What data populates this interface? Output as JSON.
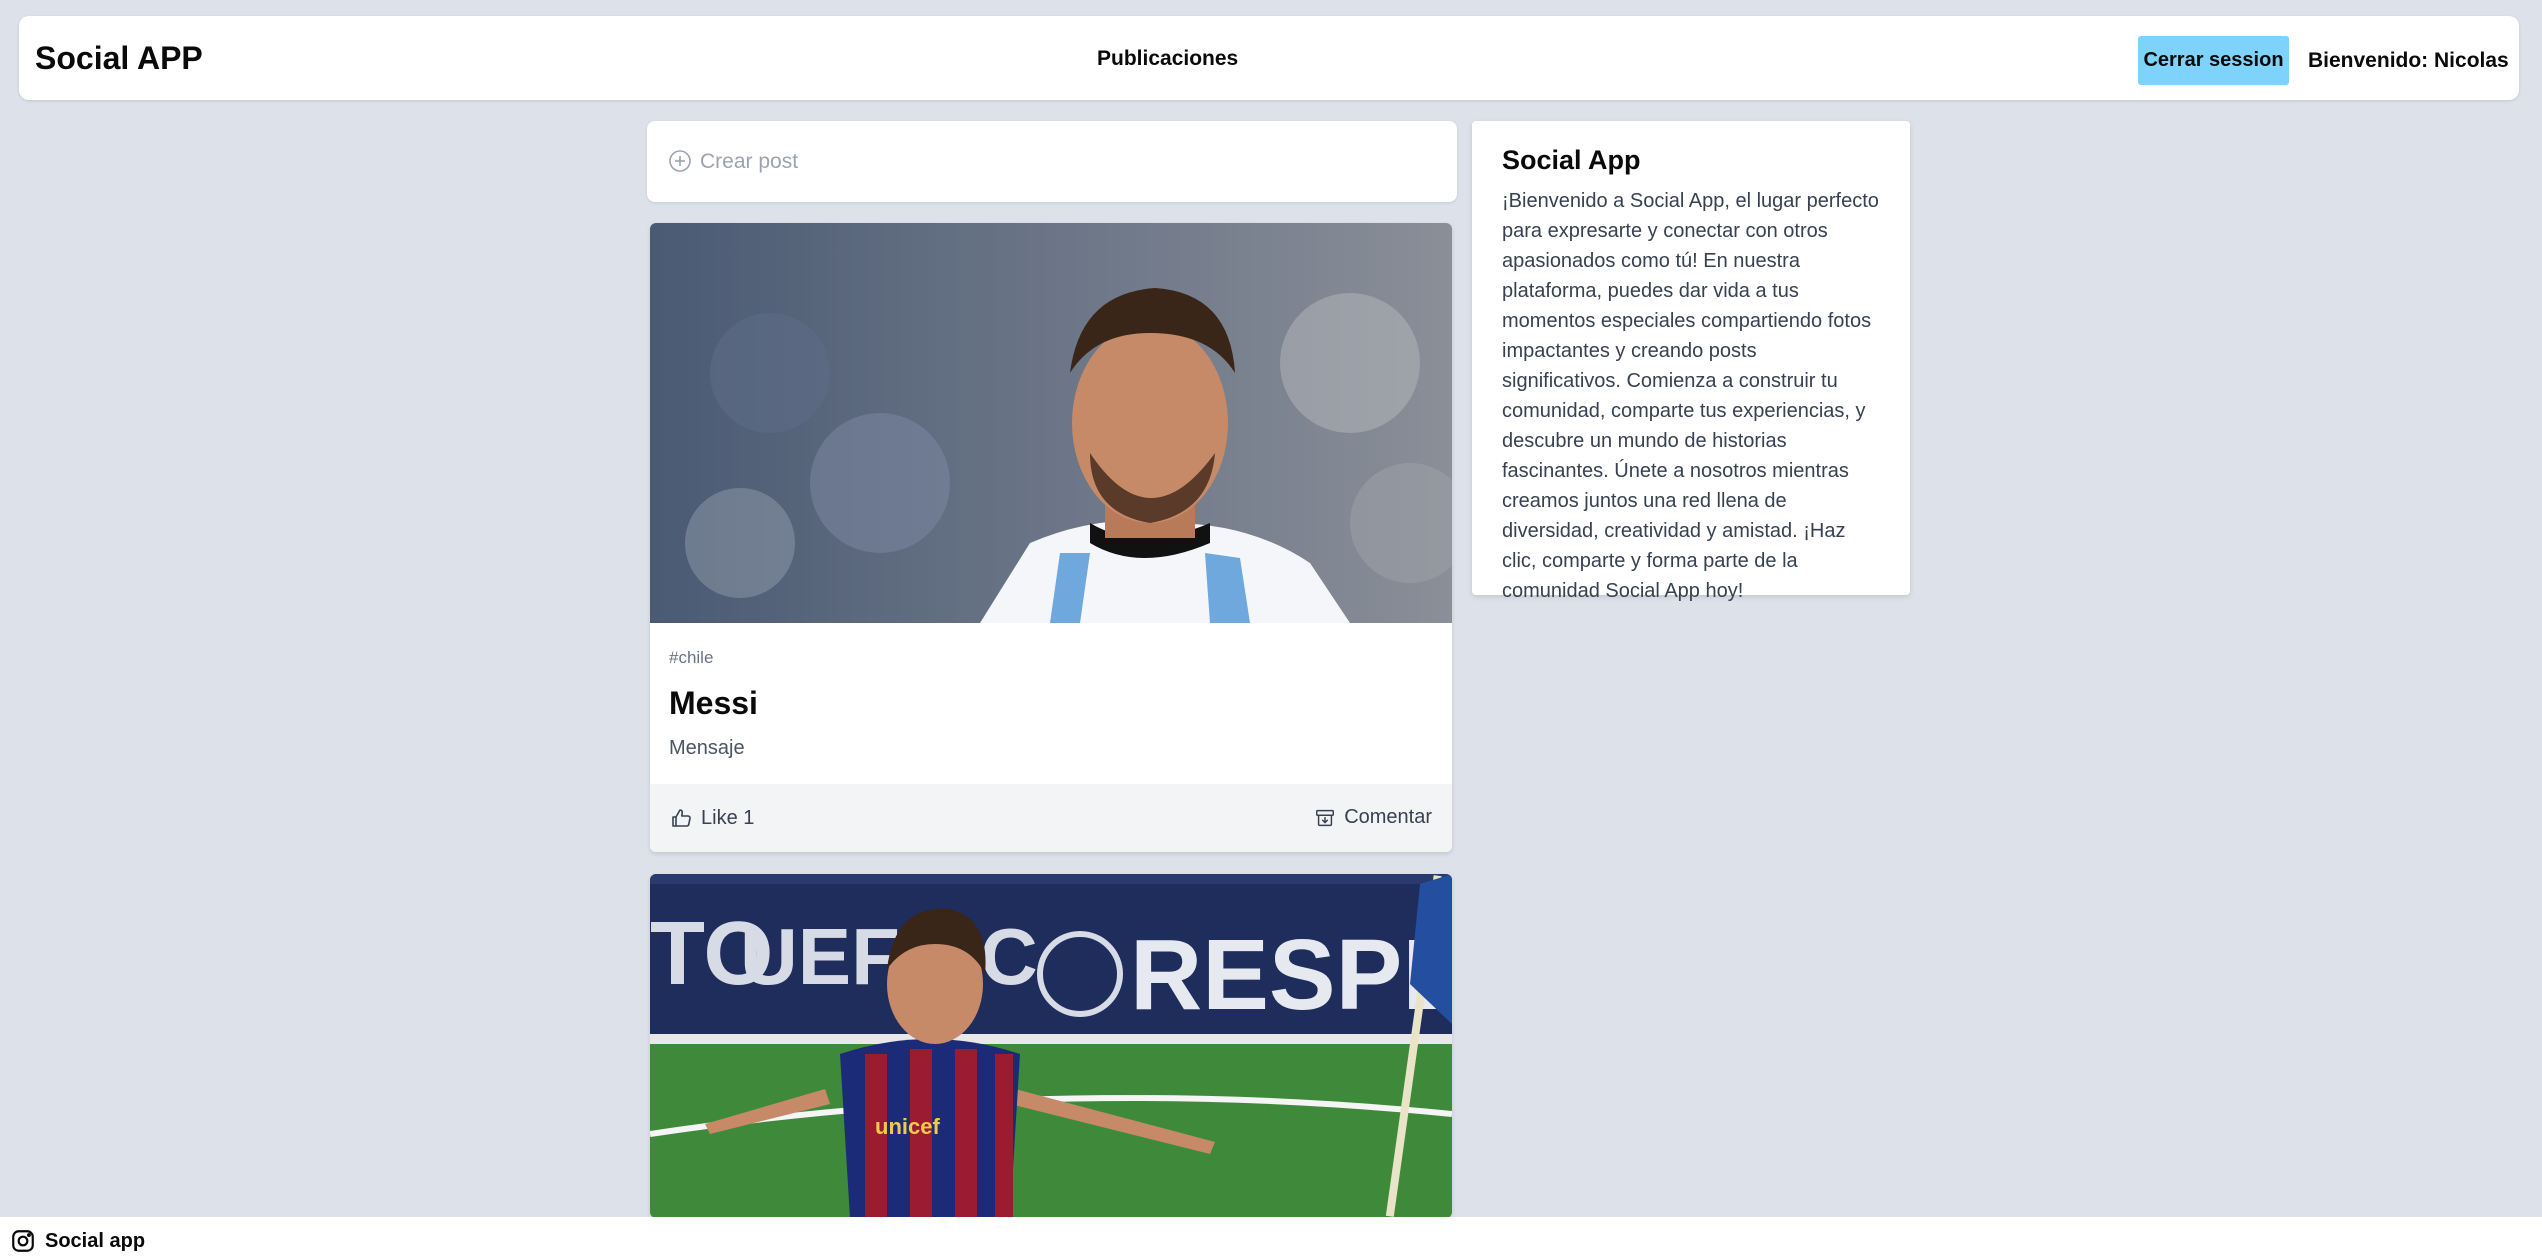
{
  "header": {
    "brand": "Social APP",
    "nav_item": "Publicaciones",
    "logout_label": "Cerrar session",
    "welcome_text": "Bienvenido: Nicolas"
  },
  "create_post": {
    "placeholder": "Crear post",
    "icon": "plus-circle-icon"
  },
  "posts": [
    {
      "image": "portrait photo of a footballer in a striped light-blue and white shirt",
      "tag": "#chile",
      "title": "Messi",
      "message": "Mensaje",
      "like_label": "Like 1",
      "comment_label": "Comentar"
    },
    {
      "image": "footballer celebrating with arms outstretched in a red and blue striped shirt"
    }
  ],
  "info": {
    "title": "Social App",
    "text": "¡Bienvenido a Social App, el lugar perfecto para expresarte y conectar con otros apasionados como tú! En nuestra plataforma, puedes dar vida a tus momentos especiales compartiendo fotos impactantes y creando posts significativos. Comienza a construir tu comunidad, comparte tus experiencias, y descubre un mundo de historias fascinantes. Únete a nosotros mientras creamos juntos una red llena de diversidad, creatividad y amistad. ¡Haz clic, comparte y forma parte de la comunidad Social App hoy!"
  },
  "footer": {
    "label": "Social app",
    "icon": "instagram-icon"
  },
  "colors": {
    "background": "#dde2ea",
    "logout_button": "#7dd3fc",
    "card": "#ffffff",
    "card_footer": "#f3f4f6"
  }
}
